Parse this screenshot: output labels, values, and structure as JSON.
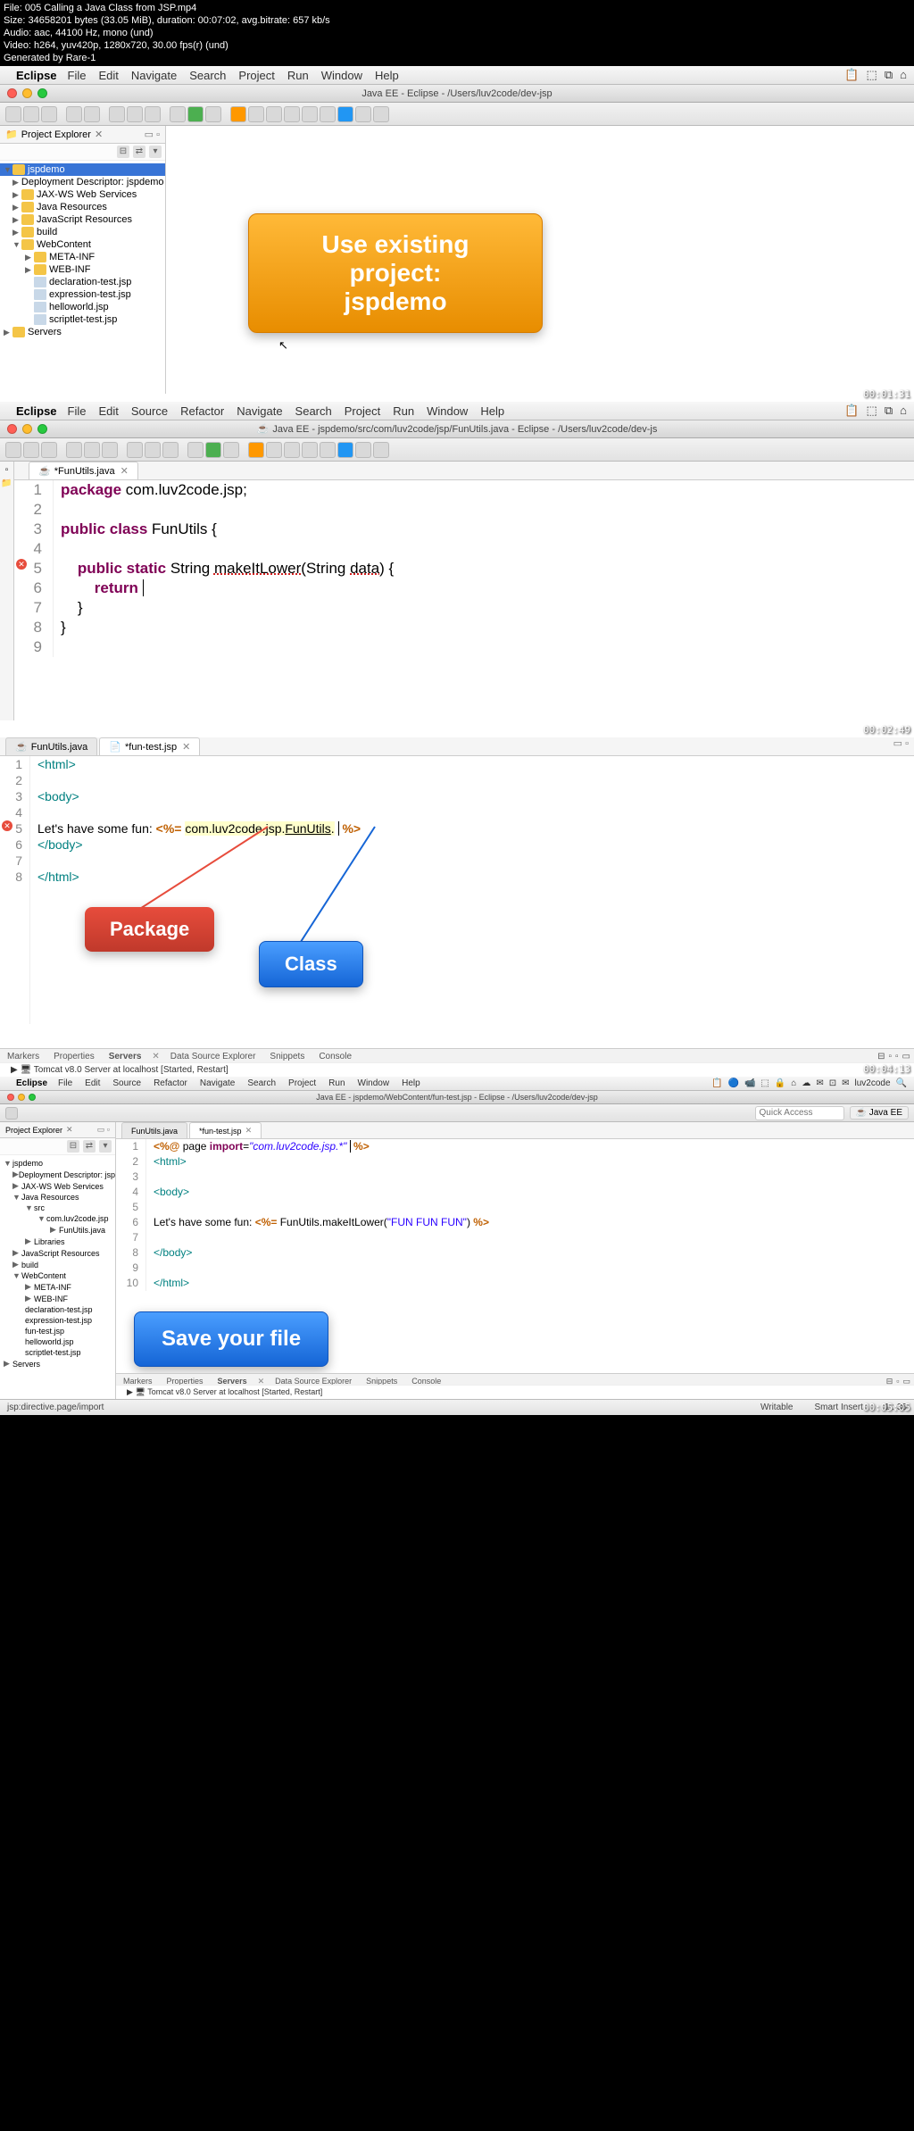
{
  "file_info": {
    "file": "File: 005 Calling a Java Class from JSP.mp4",
    "size": "Size: 34658201 bytes (33.05 MiB), duration: 00:07:02, avg.bitrate: 657 kb/s",
    "audio": "Audio: aac, 44100 Hz, mono (und)",
    "video": "Video: h264, yuv420p, 1280x720, 30.00 fps(r) (und)",
    "generated": "Generated by Rare-1"
  },
  "menubar": {
    "app": "Eclipse",
    "items_a": [
      "File",
      "Edit",
      "Navigate",
      "Search",
      "Project",
      "Run",
      "Window",
      "Help"
    ],
    "items_b": [
      "File",
      "Edit",
      "Source",
      "Refactor",
      "Navigate",
      "Search",
      "Project",
      "Run",
      "Window",
      "Help"
    ]
  },
  "titles": {
    "t1": "Java EE - Eclipse - /Users/luv2code/dev-jsp",
    "t2": "Java EE - jspdemo/src/com/luv2code/jsp/FunUtils.java - Eclipse - /Users/luv2code/dev-js",
    "t4": "Java EE - jspdemo/WebContent/fun-test.jsp - Eclipse - /Users/luv2code/dev-jsp"
  },
  "explorer": {
    "title": "Project Explorer",
    "root": "jspdemo",
    "nodes": [
      "Deployment Descriptor: jspdemo",
      "JAX-WS Web Services",
      "Java Resources",
      "JavaScript Resources",
      "build",
      "WebContent"
    ],
    "webcontent": [
      "META-INF",
      "WEB-INF",
      "declaration-test.jsp",
      "expression-test.jsp",
      "helloworld.jsp",
      "scriptlet-test.jsp"
    ],
    "servers": "Servers"
  },
  "explorer4": {
    "java_res": [
      "src",
      "com.luv2code.jsp",
      "FunUtils.java",
      "Libraries"
    ],
    "webcontent": [
      "META-INF",
      "WEB-INF",
      "declaration-test.jsp",
      "expression-test.jsp",
      "fun-test.jsp",
      "helloworld.jsp",
      "scriptlet-test.jsp"
    ]
  },
  "callouts": {
    "orange1": "Use existing project:",
    "orange2": "jspdemo",
    "package": "Package",
    "class": "Class",
    "save": "Save your file"
  },
  "timestamps": {
    "t1": "00:01:31",
    "t2": "00:02:49",
    "t3": "00:04:13",
    "t4": "00:05:05"
  },
  "editor2": {
    "tab": "*FunUtils.java",
    "lines": {
      "l1a": "package",
      "l1b": " com.luv2code.jsp;",
      "l3a": "public class",
      "l3b": " FunUtils {",
      "l5a": "public static",
      "l5b": " String ",
      "l5c": "makeItLower",
      "l5d": "(String ",
      "l5e": "data",
      "l5f": ") {",
      "l6": "return",
      "l7": "}",
      "l8": "}"
    }
  },
  "editor3": {
    "tab1": "FunUtils.java",
    "tab2": "*fun-test.jsp",
    "lines": {
      "l1": "<html>",
      "l3": "<body>",
      "l5a": "Let's have some fun: ",
      "l5b": "<%=",
      "l5c": "com.luv2code.jsp",
      "l5d": ".",
      "l5e": "FunUtils",
      "l5f": ".",
      "l5g": "%>",
      "l6": "</body>",
      "l8": "</html>"
    }
  },
  "editor4": {
    "tab1": "FunUtils.java",
    "tab2": "*fun-test.jsp",
    "lines": {
      "l1a": "<%@",
      "l1b": " page ",
      "l1c": "import",
      "l1d": "=",
      "l1e": "\"com.luv2code.jsp.*\"",
      "l1f": " %>",
      "l2": "<html>",
      "l4": "<body>",
      "l6a": "Let's have some fun: ",
      "l6b": "<%=",
      "l6c": " FunUtils.makeItLower(",
      "l6d": "\"FUN FUN FUN\"",
      "l6e": ") ",
      "l6f": "%>",
      "l8": "</body>",
      "l10": "</html>"
    }
  },
  "bottom": {
    "tabs": [
      "Markers",
      "Properties",
      "Servers",
      "Data Source Explorer",
      "Snippets",
      "Console"
    ],
    "server": "Tomcat v8.0 Server at localhost [Started, Restart]"
  },
  "status": {
    "left": "jsp:directive.page/import",
    "writable": "Writable",
    "insert": "Smart Insert",
    "pos": "1 : 36"
  },
  "quick_access": "Quick Access",
  "perspective": "Java EE",
  "user": "luv2code"
}
